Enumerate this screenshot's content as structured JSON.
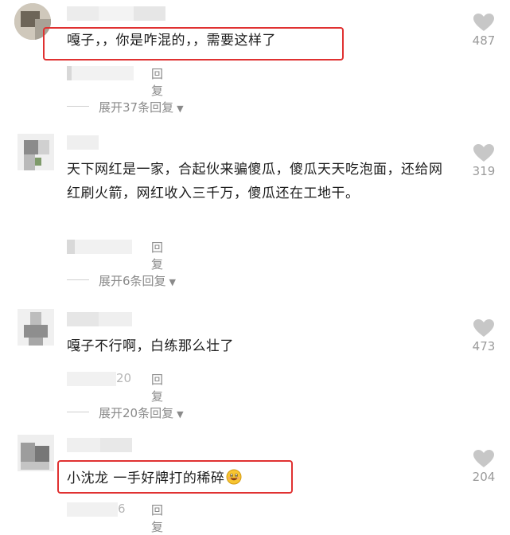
{
  "comments": [
    {
      "text": "嘎子，，你是咋混的，，需要这样了",
      "reply_label": "回复",
      "expand_label": "展开37条回复",
      "like_count": "487",
      "highlighted": true
    },
    {
      "text": "天下网红是一家，合起伙来骗傻瓜，傻瓜天天吃泡面，还给网红刷火箭，网红收入三千万，傻瓜还在工地干。",
      "reply_label": "回复",
      "expand_label": "展开6条回复",
      "like_count": "319",
      "highlighted": false
    },
    {
      "text": "嘎子不行啊，白练那么壮了",
      "reply_label": "回复",
      "date_fragment": "20",
      "expand_label": "展开20条回复",
      "like_count": "473",
      "highlighted": false
    },
    {
      "text": "小沈龙 一手好牌打的稀碎",
      "reply_label": "回复",
      "date_fragment": "6",
      "like_count": "204",
      "highlighted": true
    }
  ],
  "colors": {
    "highlight": "#e03131",
    "muted": "#9a9a9a"
  },
  "icons": {
    "like": "heart-icon",
    "expand": "caret-down-icon",
    "emoji": "grinning-face-emoji"
  }
}
